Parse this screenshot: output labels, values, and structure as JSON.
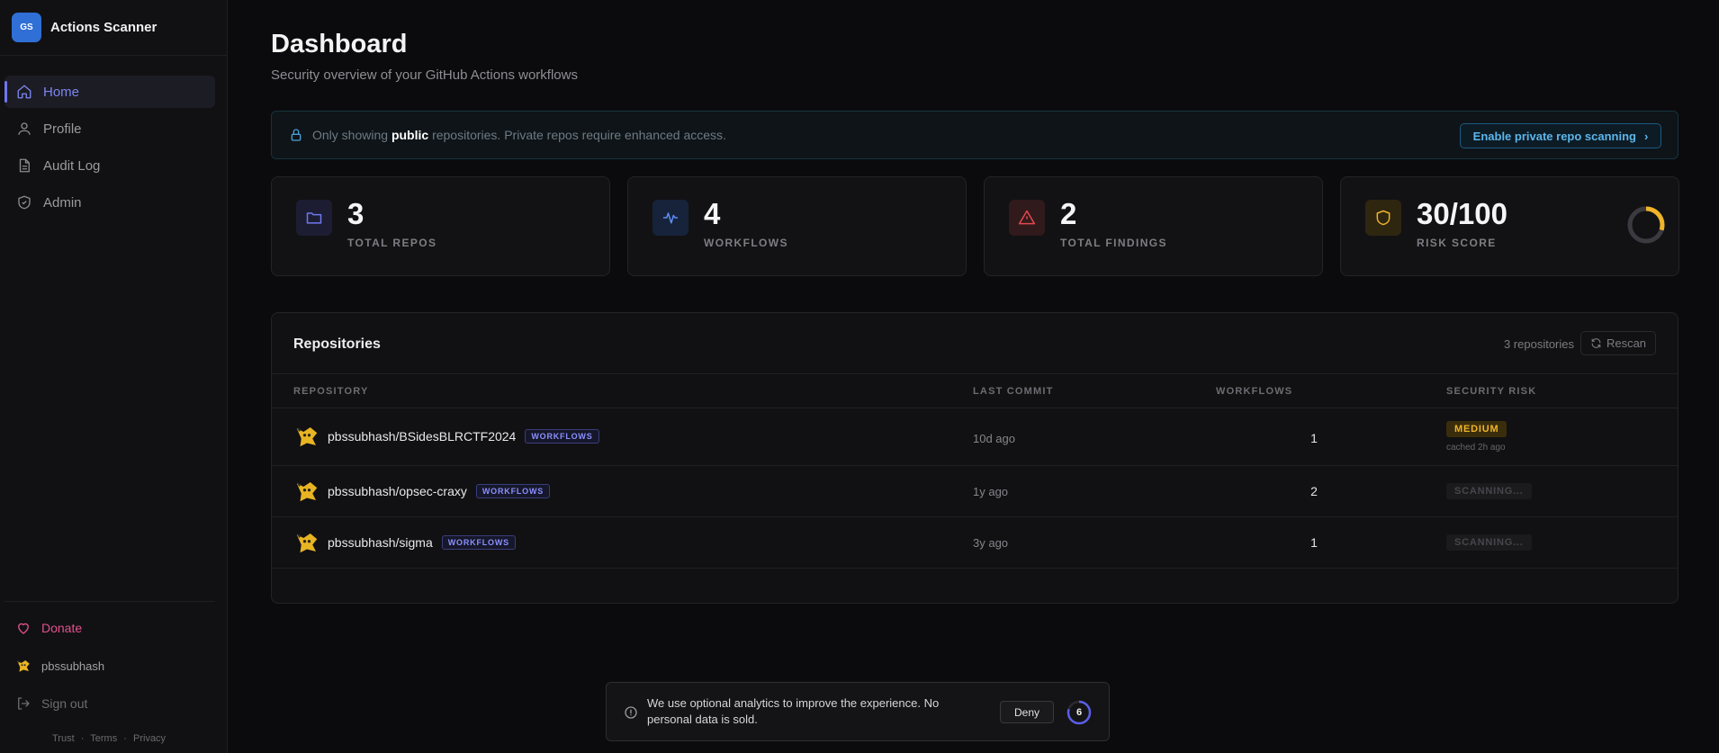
{
  "brand": {
    "initials": "GS",
    "name": "Actions Scanner"
  },
  "nav": [
    {
      "label": "Home",
      "icon": "home-icon",
      "active": true
    },
    {
      "label": "Profile",
      "icon": "user-icon",
      "active": false
    },
    {
      "label": "Audit Log",
      "icon": "document-icon",
      "active": false
    },
    {
      "label": "Admin",
      "icon": "shield-check-icon",
      "active": false
    }
  ],
  "sidebar_bottom": {
    "donate": "Donate",
    "username": "pbssubhash",
    "signout": "Sign out",
    "links": [
      "Trust",
      "Terms",
      "Privacy"
    ],
    "separator": "·"
  },
  "header": {
    "title": "Dashboard",
    "subtitle": "Security overview of your GitHub Actions workflows"
  },
  "notice": {
    "prefix": "Only showing",
    "highlight": "public",
    "suffix": "repositories. Private repos require enhanced access.",
    "button": "Enable private repo scanning",
    "button_chevron": "›"
  },
  "stats": [
    {
      "value": "3",
      "label": "TOTAL REPOS",
      "icon": "folder-icon",
      "color": "#6f78ee"
    },
    {
      "value": "4",
      "label": "WORKFLOWS",
      "icon": "activity-icon",
      "color": "#5b8ff5"
    },
    {
      "value": "2",
      "label": "TOTAL FINDINGS",
      "icon": "alert-triangle-icon",
      "color": "#e5484d"
    },
    {
      "value": "30/100",
      "label": "RISK SCORE",
      "icon": "shield-icon",
      "color": "#f0b429",
      "score_fraction": 0.3
    }
  ],
  "repos_panel": {
    "title": "Repositories",
    "count_text": "3 repositories",
    "rescan": "Rescan",
    "columns": [
      "REPOSITORY",
      "LAST COMMIT",
      "WORKFLOWS",
      "SECURITY RISK"
    ],
    "rows": [
      {
        "name": "pbssubhash/BSidesBLRCTF2024",
        "badge": "WORKFLOWS",
        "last_commit": "10d ago",
        "workflows": "1",
        "risk": "MEDIUM",
        "risk_note": "cached 2h ago"
      },
      {
        "name": "pbssubhash/opsec-craxy",
        "badge": "WORKFLOWS",
        "last_commit": "1y ago",
        "workflows": "2",
        "risk": "SCANNING...",
        "risk_note": ""
      },
      {
        "name": "pbssubhash/sigma",
        "badge": "WORKFLOWS",
        "last_commit": "3y ago",
        "workflows": "1",
        "risk": "SCANNING...",
        "risk_note": ""
      }
    ]
  },
  "consent": {
    "text": "We use optional analytics to improve the experience. No personal data is sold.",
    "deny": "Deny",
    "countdown": "6"
  },
  "colors": {
    "accent": "#6f78ee",
    "donate": "#e2508e",
    "notice_link": "#5cb5ea",
    "medium": "#f0b429"
  }
}
